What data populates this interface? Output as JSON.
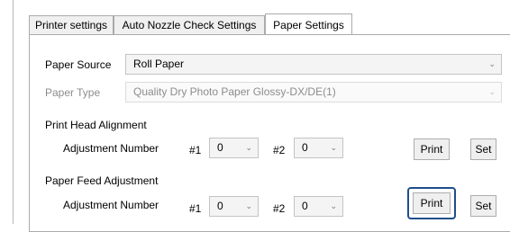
{
  "tabs": [
    {
      "label": "Printer settings"
    },
    {
      "label": "Auto Nozzle Check Settings"
    },
    {
      "label": "Paper Settings"
    }
  ],
  "paper_source": {
    "label": "Paper Source",
    "value": "Roll Paper"
  },
  "paper_type": {
    "label": "Paper Type",
    "value": "Quality Dry Photo Paper Glossy-DX/DE(1)"
  },
  "print_head_alignment": {
    "title": "Print Head Alignment",
    "adjustment_label": "Adjustment Number",
    "num1_label": "#1",
    "num1_value": "0",
    "num2_label": "#2",
    "num2_value": "0",
    "print_label": "Print",
    "set_label": "Set"
  },
  "paper_feed_adjustment": {
    "title": "Paper Feed Adjustment",
    "adjustment_label": "Adjustment Number",
    "num1_label": "#1",
    "num1_value": "0",
    "num2_label": "#2",
    "num2_value": "0",
    "print_label": "Print",
    "set_label": "Set"
  },
  "icons": {
    "dropdown": "chevron-down-icon"
  },
  "colors": {
    "focus": "#1f4e8c",
    "border": "#ababab"
  }
}
